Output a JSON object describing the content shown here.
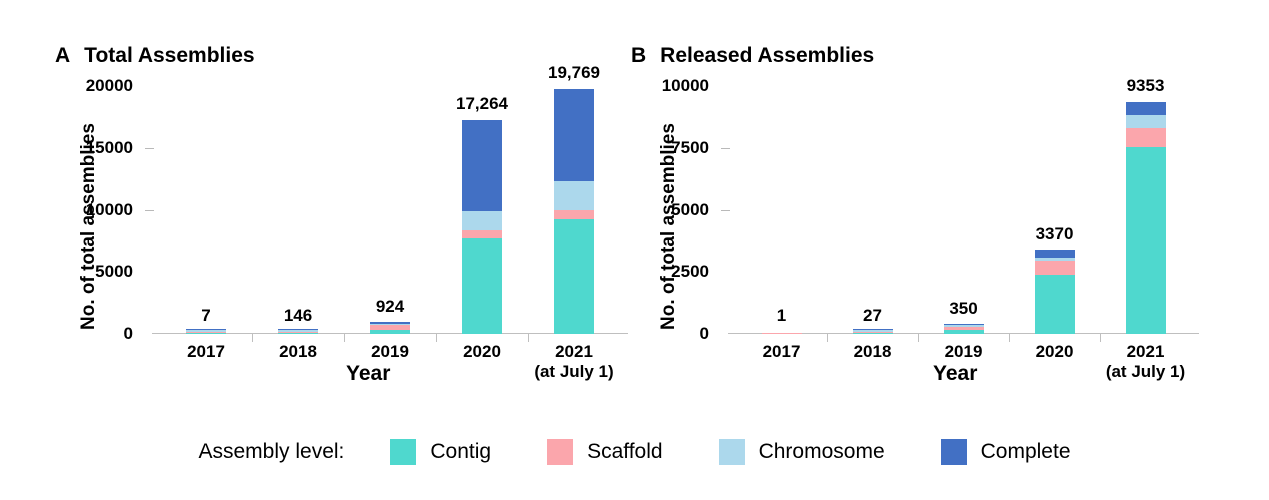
{
  "figure": {
    "legend": {
      "title": "Assembly level:",
      "items": [
        {
          "label": "Contig",
          "color": "#4FD8CE"
        },
        {
          "label": "Scaffold",
          "color": "#FBA6AC"
        },
        {
          "label": "Chromosome",
          "color": "#ACD8EC"
        },
        {
          "label": "Complete",
          "color": "#4270C4"
        }
      ]
    }
  },
  "chart_data": [
    {
      "type": "bar",
      "panel": "A",
      "title": "Total Assemblies",
      "xlabel": "Year",
      "ylabel": "No. of total assemblies",
      "ylim": [
        0,
        20000
      ],
      "yticks": [
        0,
        5000,
        10000,
        15000,
        20000
      ],
      "ytick_labels": [
        "0",
        "5000",
        "10000",
        "15000",
        "20000"
      ],
      "grid": false,
      "legend_position": "bottom",
      "stacked": true,
      "categories": [
        "2017",
        "2018",
        "2019",
        "2020",
        "2021"
      ],
      "category_sublabels": [
        "",
        "",
        "",
        "",
        "(at July 1)"
      ],
      "series": [
        {
          "name": "Contig",
          "color": "#4FD8CE",
          "values": [
            2,
            54,
            361,
            7743,
            9247
          ]
        },
        {
          "name": "Scaffold",
          "color": "#FBA6AC",
          "values": [
            2,
            27,
            330,
            649,
            761
          ]
        },
        {
          "name": "Chromosome",
          "color": "#ACD8EC",
          "values": [
            1,
            24,
            66,
            1521,
            2322
          ]
        },
        {
          "name": "Complete",
          "color": "#4270C4",
          "values": [
            2,
            41,
            167,
            7351,
            7439
          ]
        }
      ],
      "totals": [
        7,
        146,
        924,
        17264,
        19769
      ],
      "total_labels": [
        "7",
        "146",
        "924",
        "17,264",
        "19,769"
      ]
    },
    {
      "type": "bar",
      "panel": "B",
      "title": "Released Assemblies",
      "xlabel": "Year",
      "ylabel": "No. of total assemblies",
      "ylim": [
        0,
        10000
      ],
      "yticks": [
        0,
        2500,
        5000,
        7500,
        10000
      ],
      "ytick_labels": [
        "0",
        "2500",
        "5000",
        "7500",
        "10000"
      ],
      "grid": false,
      "legend_position": "bottom",
      "stacked": true,
      "categories": [
        "2017",
        "2018",
        "2019",
        "2020",
        "2021"
      ],
      "category_sublabels": [
        "",
        "",
        "",
        "",
        "(at July 1)"
      ],
      "series": [
        {
          "name": "Contig",
          "color": "#4FD8CE",
          "values": [
            0,
            7,
            180,
            2370,
            7560
          ]
        },
        {
          "name": "Scaffold",
          "color": "#FBA6AC",
          "values": [
            1,
            12,
            120,
            560,
            730
          ]
        },
        {
          "name": "Chromosome",
          "color": "#ACD8EC",
          "values": [
            0,
            4,
            20,
            150,
            560
          ]
        },
        {
          "name": "Complete",
          "color": "#4270C4",
          "values": [
            0,
            4,
            30,
            290,
            503
          ]
        }
      ],
      "totals": [
        1,
        27,
        350,
        3370,
        9353
      ],
      "total_labels": [
        "1",
        "27",
        "350",
        "3370",
        "9353"
      ]
    }
  ]
}
